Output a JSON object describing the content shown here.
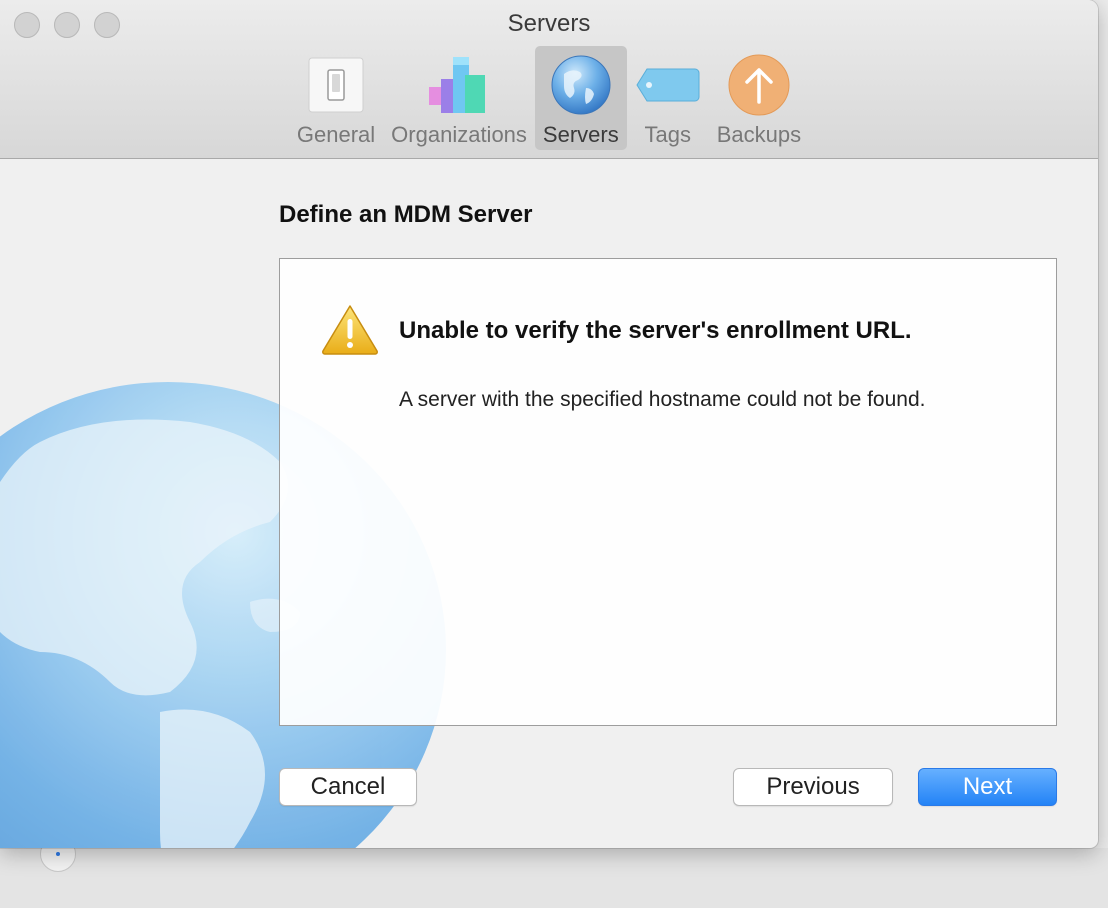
{
  "window": {
    "title": "Servers"
  },
  "toolbar": {
    "items": [
      {
        "label": "General",
        "icon": "switch-icon",
        "selected": false
      },
      {
        "label": "Organizations",
        "icon": "blocks-icon",
        "selected": false
      },
      {
        "label": "Servers",
        "icon": "globe-icon",
        "selected": true
      },
      {
        "label": "Tags",
        "icon": "tag-icon",
        "selected": false
      },
      {
        "label": "Backups",
        "icon": "up-arrow-icon",
        "selected": false
      }
    ]
  },
  "main": {
    "heading": "Define an MDM Server",
    "message": {
      "icon": "warning-icon",
      "title": "Unable to verify the server's enrollment URL.",
      "body": "A server with the specified hostname could not be found."
    }
  },
  "buttons": {
    "cancel": "Cancel",
    "previous": "Previous",
    "next": "Next"
  },
  "colors": {
    "accent": "#2383f6",
    "warning": "#f2c43a"
  }
}
